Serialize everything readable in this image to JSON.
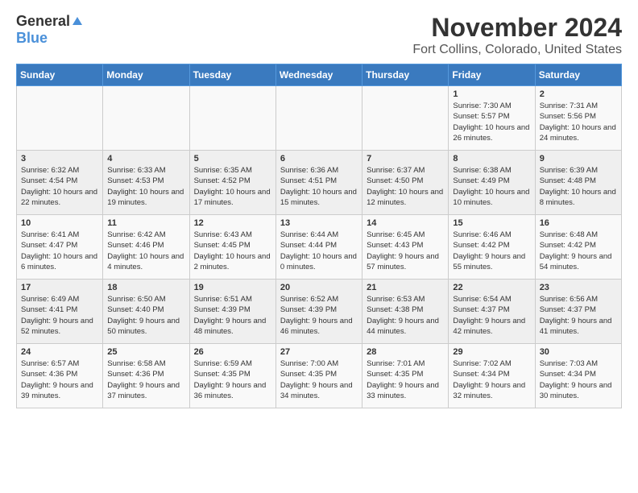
{
  "logo": {
    "general": "General",
    "blue": "Blue"
  },
  "title": "November 2024",
  "location": "Fort Collins, Colorado, United States",
  "days_of_week": [
    "Sunday",
    "Monday",
    "Tuesday",
    "Wednesday",
    "Thursday",
    "Friday",
    "Saturday"
  ],
  "weeks": [
    [
      {
        "day": "",
        "info": ""
      },
      {
        "day": "",
        "info": ""
      },
      {
        "day": "",
        "info": ""
      },
      {
        "day": "",
        "info": ""
      },
      {
        "day": "",
        "info": ""
      },
      {
        "day": "1",
        "info": "Sunrise: 7:30 AM\nSunset: 5:57 PM\nDaylight: 10 hours and 26 minutes."
      },
      {
        "day": "2",
        "info": "Sunrise: 7:31 AM\nSunset: 5:56 PM\nDaylight: 10 hours and 24 minutes."
      }
    ],
    [
      {
        "day": "3",
        "info": "Sunrise: 6:32 AM\nSunset: 4:54 PM\nDaylight: 10 hours and 22 minutes."
      },
      {
        "day": "4",
        "info": "Sunrise: 6:33 AM\nSunset: 4:53 PM\nDaylight: 10 hours and 19 minutes."
      },
      {
        "day": "5",
        "info": "Sunrise: 6:35 AM\nSunset: 4:52 PM\nDaylight: 10 hours and 17 minutes."
      },
      {
        "day": "6",
        "info": "Sunrise: 6:36 AM\nSunset: 4:51 PM\nDaylight: 10 hours and 15 minutes."
      },
      {
        "day": "7",
        "info": "Sunrise: 6:37 AM\nSunset: 4:50 PM\nDaylight: 10 hours and 12 minutes."
      },
      {
        "day": "8",
        "info": "Sunrise: 6:38 AM\nSunset: 4:49 PM\nDaylight: 10 hours and 10 minutes."
      },
      {
        "day": "9",
        "info": "Sunrise: 6:39 AM\nSunset: 4:48 PM\nDaylight: 10 hours and 8 minutes."
      }
    ],
    [
      {
        "day": "10",
        "info": "Sunrise: 6:41 AM\nSunset: 4:47 PM\nDaylight: 10 hours and 6 minutes."
      },
      {
        "day": "11",
        "info": "Sunrise: 6:42 AM\nSunset: 4:46 PM\nDaylight: 10 hours and 4 minutes."
      },
      {
        "day": "12",
        "info": "Sunrise: 6:43 AM\nSunset: 4:45 PM\nDaylight: 10 hours and 2 minutes."
      },
      {
        "day": "13",
        "info": "Sunrise: 6:44 AM\nSunset: 4:44 PM\nDaylight: 10 hours and 0 minutes."
      },
      {
        "day": "14",
        "info": "Sunrise: 6:45 AM\nSunset: 4:43 PM\nDaylight: 9 hours and 57 minutes."
      },
      {
        "day": "15",
        "info": "Sunrise: 6:46 AM\nSunset: 4:42 PM\nDaylight: 9 hours and 55 minutes."
      },
      {
        "day": "16",
        "info": "Sunrise: 6:48 AM\nSunset: 4:42 PM\nDaylight: 9 hours and 54 minutes."
      }
    ],
    [
      {
        "day": "17",
        "info": "Sunrise: 6:49 AM\nSunset: 4:41 PM\nDaylight: 9 hours and 52 minutes."
      },
      {
        "day": "18",
        "info": "Sunrise: 6:50 AM\nSunset: 4:40 PM\nDaylight: 9 hours and 50 minutes."
      },
      {
        "day": "19",
        "info": "Sunrise: 6:51 AM\nSunset: 4:39 PM\nDaylight: 9 hours and 48 minutes."
      },
      {
        "day": "20",
        "info": "Sunrise: 6:52 AM\nSunset: 4:39 PM\nDaylight: 9 hours and 46 minutes."
      },
      {
        "day": "21",
        "info": "Sunrise: 6:53 AM\nSunset: 4:38 PM\nDaylight: 9 hours and 44 minutes."
      },
      {
        "day": "22",
        "info": "Sunrise: 6:54 AM\nSunset: 4:37 PM\nDaylight: 9 hours and 42 minutes."
      },
      {
        "day": "23",
        "info": "Sunrise: 6:56 AM\nSunset: 4:37 PM\nDaylight: 9 hours and 41 minutes."
      }
    ],
    [
      {
        "day": "24",
        "info": "Sunrise: 6:57 AM\nSunset: 4:36 PM\nDaylight: 9 hours and 39 minutes."
      },
      {
        "day": "25",
        "info": "Sunrise: 6:58 AM\nSunset: 4:36 PM\nDaylight: 9 hours and 37 minutes."
      },
      {
        "day": "26",
        "info": "Sunrise: 6:59 AM\nSunset: 4:35 PM\nDaylight: 9 hours and 36 minutes."
      },
      {
        "day": "27",
        "info": "Sunrise: 7:00 AM\nSunset: 4:35 PM\nDaylight: 9 hours and 34 minutes."
      },
      {
        "day": "28",
        "info": "Sunrise: 7:01 AM\nSunset: 4:35 PM\nDaylight: 9 hours and 33 minutes."
      },
      {
        "day": "29",
        "info": "Sunrise: 7:02 AM\nSunset: 4:34 PM\nDaylight: 9 hours and 32 minutes."
      },
      {
        "day": "30",
        "info": "Sunrise: 7:03 AM\nSunset: 4:34 PM\nDaylight: 9 hours and 30 minutes."
      }
    ]
  ]
}
